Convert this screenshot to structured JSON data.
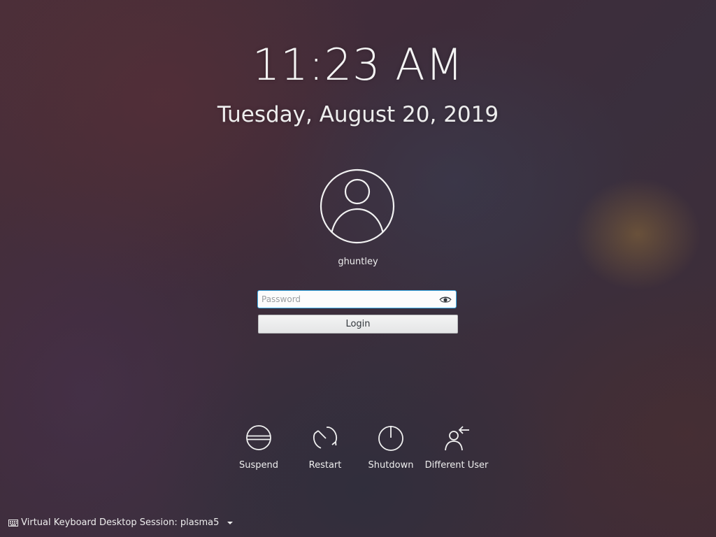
{
  "lockscreen": {
    "time": "11:23 AM",
    "date": "Tuesday, August 20, 2019"
  },
  "user": {
    "name": "ghuntley",
    "avatar_icon": "user-avatar-icon"
  },
  "login": {
    "password_placeholder": "Password",
    "password_value": "",
    "reveal_icon": "eye-icon",
    "button_label": "Login",
    "focus_color": "#3daee9"
  },
  "actions": [
    {
      "label": "Suspend",
      "icon": "suspend-icon"
    },
    {
      "label": "Restart",
      "icon": "restart-icon"
    },
    {
      "label": "Shutdown",
      "icon": "power-icon"
    },
    {
      "label": "Different User",
      "icon": "switch-user-icon"
    }
  ],
  "footer": {
    "keyboard_label": "Virtual Keyboard",
    "keyboard_icon": "keyboard-icon",
    "session_label": "Desktop Session: plasma5",
    "session_icon": "dropdown-arrow-icon"
  }
}
